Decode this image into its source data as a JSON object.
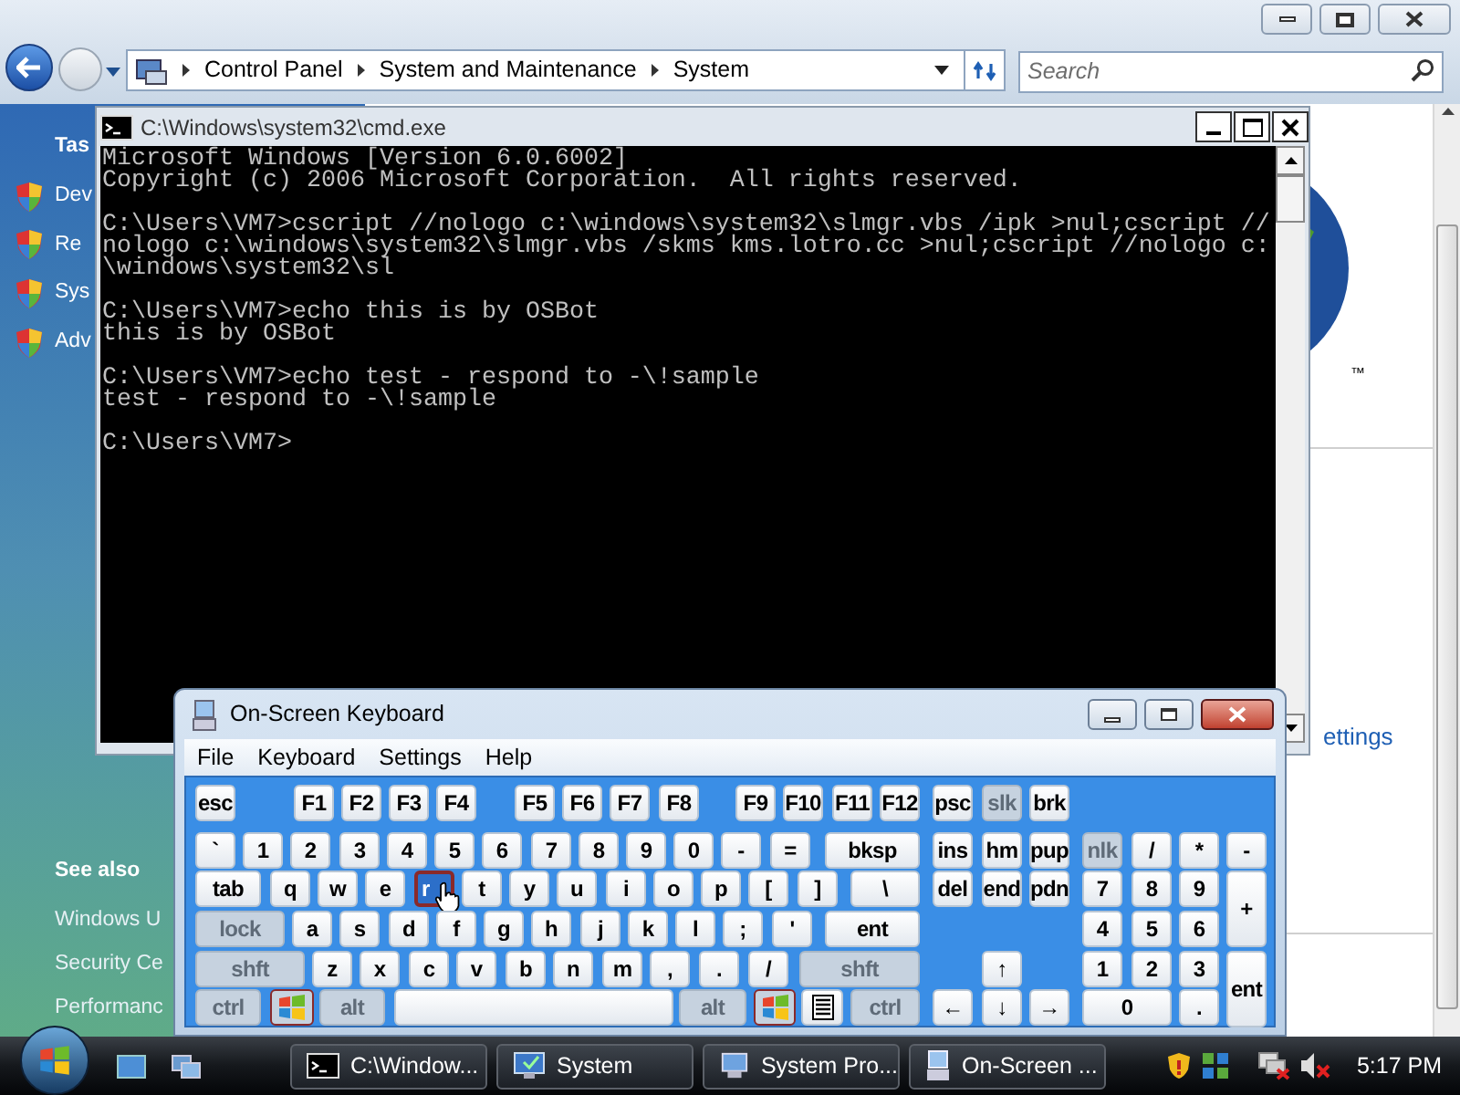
{
  "explorer": {
    "address": [
      "Control Panel",
      "System and Maintenance",
      "System"
    ],
    "search": {
      "placeholder": "Search"
    },
    "tasks_heading": "Tas",
    "tasks": [
      "Dev",
      "Re",
      "Sys",
      "Adv"
    ],
    "see_also": {
      "heading": "See also",
      "links": [
        "Windows U",
        "Security Ce",
        "Performanc"
      ]
    },
    "trademark": "™",
    "link": "ettings"
  },
  "cmd": {
    "title": "C:\\Windows\\system32\\cmd.exe",
    "blocks": [
      [
        "Microsoft Windows [Version 6.0.6002]",
        "Copyright (c) 2006 Microsoft Corporation.  All rights reserved."
      ],
      [
        "C:\\Users\\VM7>cscript //nologo c:\\windows\\system32\\slmgr.vbs /ipk >nul;cscript //",
        "nologo c:\\windows\\system32\\slmgr.vbs /skms kms.lotro.cc >nul;cscript //nologo c:",
        "\\windows\\system32\\sl"
      ],
      [
        "C:\\Users\\VM7>echo this is by OSBot",
        "this is by OSBot"
      ],
      [
        "C:\\Users\\VM7>echo test - respond to -\\!sample",
        "test - respond to -\\!sample"
      ],
      [
        "C:\\Users\\VM7>"
      ]
    ]
  },
  "keyboard": {
    "title": "On-Screen Keyboard",
    "menu": [
      "File",
      "Keyboard",
      "Settings",
      "Help"
    ],
    "top_row": [
      {
        "label": "esc",
        "kind": "key"
      },
      {
        "label": "F1",
        "kind": "key"
      },
      {
        "label": "F2",
        "kind": "key"
      },
      {
        "label": "F3",
        "kind": "key"
      },
      {
        "label": "F4",
        "kind": "key"
      },
      {
        "label": "F5",
        "kind": "key"
      },
      {
        "label": "F6",
        "kind": "key"
      },
      {
        "label": "F7",
        "kind": "key"
      },
      {
        "label": "F8",
        "kind": "key"
      },
      {
        "label": "F9",
        "kind": "key"
      },
      {
        "label": "F10",
        "kind": "key"
      },
      {
        "label": "F11",
        "kind": "key"
      },
      {
        "label": "F12",
        "kind": "key"
      },
      {
        "label": "psc",
        "kind": "key"
      },
      {
        "label": "slk",
        "kind": "modifier"
      },
      {
        "label": "brk",
        "kind": "key"
      }
    ],
    "main": [
      [
        {
          "label": "`",
          "kind": "key"
        },
        {
          "label": "1",
          "kind": "key"
        },
        {
          "label": "2",
          "kind": "key"
        },
        {
          "label": "3",
          "kind": "key"
        },
        {
          "label": "4",
          "kind": "key"
        },
        {
          "label": "5",
          "kind": "key"
        },
        {
          "label": "6",
          "kind": "key"
        },
        {
          "label": "7",
          "kind": "key"
        },
        {
          "label": "8",
          "kind": "key"
        },
        {
          "label": "9",
          "kind": "key"
        },
        {
          "label": "0",
          "kind": "key"
        },
        {
          "label": "-",
          "kind": "key"
        },
        {
          "label": "=",
          "kind": "key"
        },
        {
          "label": "bksp",
          "kind": "key"
        }
      ],
      [
        {
          "label": "tab",
          "kind": "key"
        },
        {
          "label": "q",
          "kind": "key"
        },
        {
          "label": "w",
          "kind": "key"
        },
        {
          "label": "e",
          "kind": "key"
        },
        {
          "label": "r",
          "kind": "hovered"
        },
        {
          "label": "t",
          "kind": "key"
        },
        {
          "label": "y",
          "kind": "key"
        },
        {
          "label": "u",
          "kind": "key"
        },
        {
          "label": "i",
          "kind": "key"
        },
        {
          "label": "o",
          "kind": "key"
        },
        {
          "label": "p",
          "kind": "key"
        },
        {
          "label": "[",
          "kind": "key"
        },
        {
          "label": "]",
          "kind": "key"
        },
        {
          "label": "\\",
          "kind": "key"
        }
      ],
      [
        {
          "label": "lock",
          "kind": "modifier"
        },
        {
          "label": "a",
          "kind": "key"
        },
        {
          "label": "s",
          "kind": "key"
        },
        {
          "label": "d",
          "kind": "key"
        },
        {
          "label": "f",
          "kind": "key"
        },
        {
          "label": "g",
          "kind": "key"
        },
        {
          "label": "h",
          "kind": "key"
        },
        {
          "label": "j",
          "kind": "key"
        },
        {
          "label": "k",
          "kind": "key"
        },
        {
          "label": "l",
          "kind": "key"
        },
        {
          "label": ";",
          "kind": "key"
        },
        {
          "label": "'",
          "kind": "key"
        },
        {
          "label": "ent",
          "kind": "key"
        }
      ],
      [
        {
          "label": "shft",
          "kind": "modifier"
        },
        {
          "label": "z",
          "kind": "key"
        },
        {
          "label": "x",
          "kind": "key"
        },
        {
          "label": "c",
          "kind": "key"
        },
        {
          "label": "v",
          "kind": "key"
        },
        {
          "label": "b",
          "kind": "key"
        },
        {
          "label": "n",
          "kind": "key"
        },
        {
          "label": "m",
          "kind": "key"
        },
        {
          "label": ",",
          "kind": "key"
        },
        {
          "label": ".",
          "kind": "key"
        },
        {
          "label": "/",
          "kind": "key"
        },
        {
          "label": "shft",
          "kind": "modifier"
        }
      ],
      [
        {
          "label": "ctrl",
          "kind": "modifier"
        },
        {
          "kind": "windows"
        },
        {
          "label": "alt",
          "kind": "modifier"
        },
        {
          "kind": "space"
        },
        {
          "label": "alt",
          "kind": "modifier"
        },
        {
          "kind": "windows"
        },
        {
          "kind": "menu"
        },
        {
          "label": "ctrl",
          "kind": "modifier"
        }
      ]
    ],
    "nav": [
      [
        {
          "label": "ins",
          "kind": "key"
        },
        {
          "label": "hm",
          "kind": "key"
        },
        {
          "label": "pup",
          "kind": "key"
        }
      ],
      [
        {
          "label": "del",
          "kind": "key"
        },
        {
          "label": "end",
          "kind": "key"
        },
        {
          "label": "pdn",
          "kind": "key"
        }
      ]
    ],
    "arrow_up": [
      {
        "label": "↑",
        "kind": "key"
      }
    ],
    "arrows": [
      {
        "label": "←",
        "kind": "key"
      },
      {
        "label": "↓",
        "kind": "key"
      },
      {
        "label": "→",
        "kind": "key"
      }
    ],
    "numpad": [
      [
        {
          "label": "nlk",
          "kind": "modifier"
        },
        {
          "label": "/",
          "kind": "key"
        },
        {
          "label": "*",
          "kind": "key"
        },
        {
          "label": "-",
          "kind": "key"
        }
      ],
      [
        {
          "label": "7",
          "kind": "key"
        },
        {
          "label": "8",
          "kind": "key"
        },
        {
          "label": "9",
          "kind": "key"
        },
        {
          "label": "+",
          "kind": "key"
        }
      ],
      [
        {
          "label": "4",
          "kind": "key"
        },
        {
          "label": "5",
          "kind": "key"
        },
        {
          "label": "6",
          "kind": "key"
        }
      ],
      [
        {
          "label": "1",
          "kind": "key"
        },
        {
          "label": "2",
          "kind": "key"
        },
        {
          "label": "3",
          "kind": "key"
        },
        {
          "label": "ent",
          "kind": "key"
        }
      ]
    ],
    "numpad_bottom": [
      {
        "label": "0",
        "kind": "key"
      },
      {
        "label": ".",
        "kind": "key"
      }
    ]
  },
  "taskbar": {
    "tasks": [
      {
        "label": "C:\\Window...",
        "kind": "console"
      },
      {
        "label": "System",
        "kind": "system"
      },
      {
        "label": "System Pro...",
        "kind": "properties"
      },
      {
        "label": "On-Screen ...",
        "kind": "keyboard"
      }
    ],
    "clock": "5:17 PM"
  }
}
